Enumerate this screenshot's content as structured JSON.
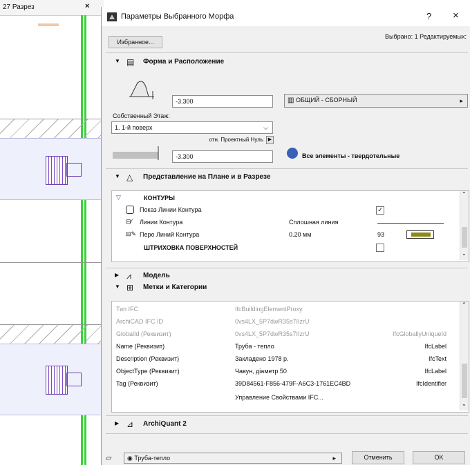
{
  "left_view": {
    "tab_title": "27 Разрез",
    "tab_close": "×"
  },
  "dialog": {
    "title": "Параметры Выбранного Морфа",
    "help": "?",
    "close": "×",
    "favorites_button": "Избранное...",
    "selection_info": "Выбрано: 1 Редактируемых:"
  },
  "section_form": {
    "title": "Форма и Расположение",
    "top_offset_value": "-3.300",
    "home_story_label": "Собственный Этаж:",
    "home_story_value": "1. 1-й поверх",
    "ref_label": "отн. Проектный Нуль",
    "bottom_offset_value": "-3.300",
    "layer_value": "ОБЩИЙ - СБОРНЫЙ",
    "solid_elements_label": "Все элементы - твердотельные"
  },
  "section_plan": {
    "title": "Представление на Плане и в Разрезе",
    "group_header": "КОНТУРЫ",
    "rows": [
      {
        "label": "Показ Линии Контура",
        "value": "",
        "checked": "✓"
      },
      {
        "label": "Линии Контура",
        "value": "Сплошная линия"
      },
      {
        "label": "Перо Линий Контура",
        "value": "0.20 мм",
        "pen": "93"
      }
    ],
    "hatch_header": "ШТРИХОВКА ПОВЕРХНОСТЕЙ"
  },
  "section_model": {
    "title": "Модель"
  },
  "section_tags": {
    "title": "Метки и Категории",
    "rows": [
      {
        "name": "Тип IFC",
        "value": "IfcBuildingElementProxy",
        "type": ""
      },
      {
        "name": "ArchiCAD IFC ID",
        "value": "0vs4LX_5P7dwR35s7IIzrU",
        "type": ""
      },
      {
        "name": "GlobalId (Реквизит)",
        "value": "0vs4LX_5P7dwR35s7IIzrU",
        "type": "IfcGloballyUniqueId"
      },
      {
        "name": "Name (Реквизит)",
        "value": "Труба - тепло",
        "type": "IfcLabel"
      },
      {
        "name": "Description (Реквизит)",
        "value": "Закладено 1978 р.",
        "type": "IfcText"
      },
      {
        "name": "ObjectType (Реквизит)",
        "value": "Чавун, діаметр 50",
        "type": "IfcLabel"
      },
      {
        "name": "Tag (Реквизит)",
        "value": "39D84561-F856-479F-A6C3-1761EC4BD",
        "type": "IfcIdentifier"
      }
    ],
    "manage_link": "Управление Свойствами IFC..."
  },
  "section_archiquant": {
    "title": "ArchiQuant 2"
  },
  "footer": {
    "favorite_name": "Труба-тепло",
    "cancel_button": "Отменить",
    "ok_button": "OK"
  },
  "colors": {
    "wall_line": "#3bd23b",
    "radiator": "#7a48c4",
    "pen_swatch": "#8a8a1a"
  }
}
